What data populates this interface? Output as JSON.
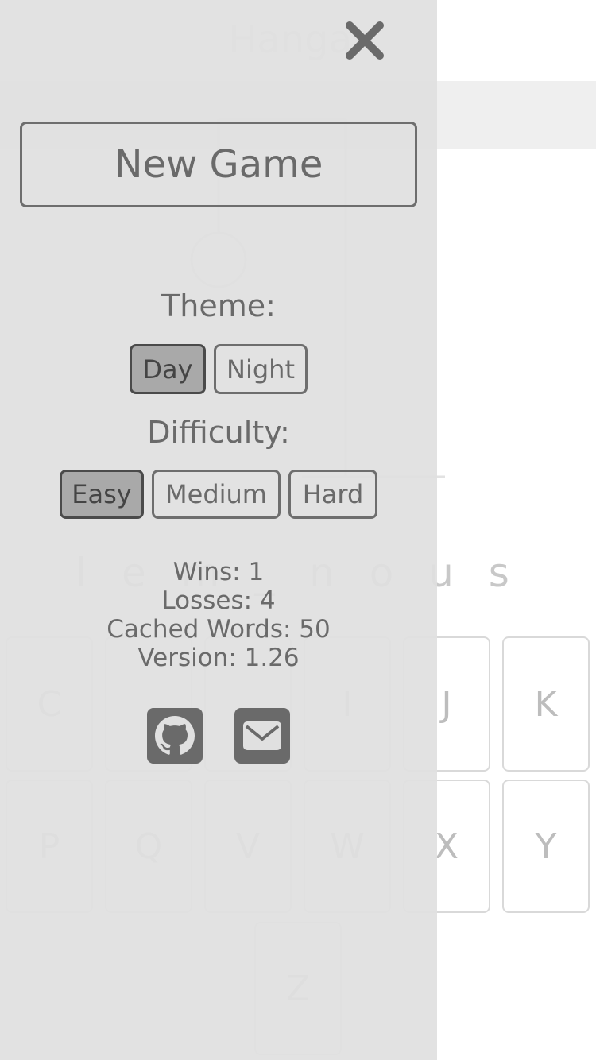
{
  "background": {
    "title": "Hangar",
    "word": "l e m _ n o u s",
    "keys_row1": [
      "G",
      "H",
      "I",
      "J",
      "K"
    ],
    "keys_row2": [
      "P",
      "Q",
      "V",
      "W",
      "X",
      "Y"
    ],
    "keys_row3": [
      "Z"
    ]
  },
  "menu": {
    "new_game_label": "New Game",
    "theme_label": "Theme:",
    "theme_options": [
      "Day",
      "Night"
    ],
    "theme_selected": "Day",
    "difficulty_label": "Difficulty:",
    "difficulty_options": [
      "Easy",
      "Medium",
      "Hard"
    ],
    "difficulty_selected": "Easy",
    "stats": {
      "wins": "Wins: 1",
      "losses": "Losses: 4",
      "cached": "Cached Words: 50",
      "version": "Version: 1.26"
    },
    "icons": [
      "github-icon",
      "email-icon",
      "close-icon"
    ]
  },
  "colors": {
    "scrim": "#e0e0e0",
    "border": "#6e6e6e",
    "active_fill": "#a9a9a9",
    "text": "#6a6a6a"
  }
}
